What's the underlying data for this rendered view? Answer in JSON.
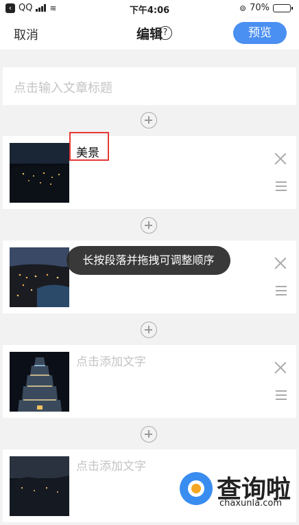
{
  "status_bar": {
    "carrier": "QQ",
    "time": "下午4:06",
    "battery_percent": "70%",
    "battery_level": 0.7
  },
  "nav": {
    "cancel_label": "取消",
    "title": "编辑",
    "help_glyph": "?",
    "preview_label": "预览"
  },
  "title_input": {
    "placeholder": "点击输入文章标题"
  },
  "paragraphs": [
    {
      "text": "美景",
      "image": "night-city-view",
      "filled": true
    },
    {
      "text": "",
      "image": "night-city-river",
      "filled": false
    },
    {
      "text": "点击添加文字",
      "image": "lit-pagoda-tower",
      "filled": false
    },
    {
      "text": "点击添加文字",
      "image": "night-city-dusk",
      "filled": false
    }
  ],
  "toast": {
    "text": "长按段落并拖拽可调整顺序"
  },
  "watermark": {
    "name": "查询啦",
    "domain": "chaxunla.com"
  },
  "colors": {
    "accent": "#4a8ff2",
    "highlight": "#e53935",
    "toast_bg": "#282828"
  }
}
